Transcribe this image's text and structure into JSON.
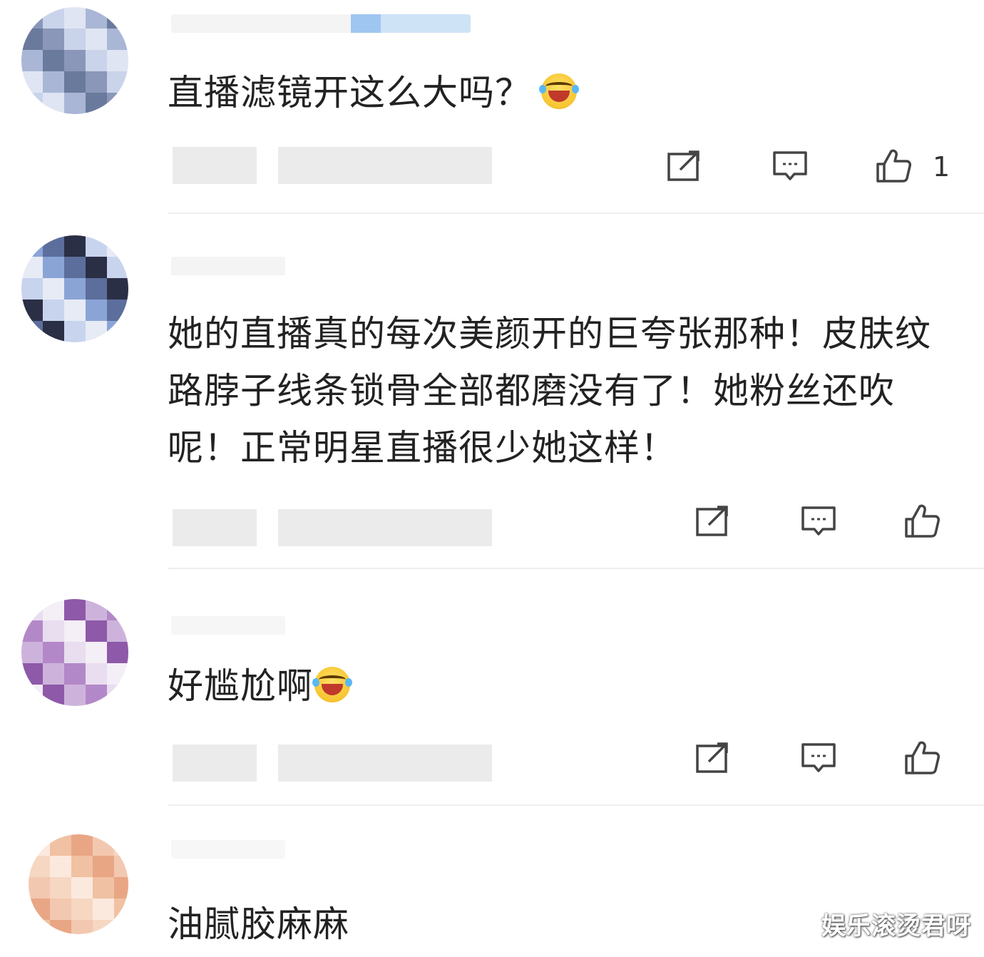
{
  "comments": [
    {
      "text": "直播滤镜开这么大吗？",
      "emoji": "laughing-tears-emoji",
      "like_count": "1",
      "avatar_colors": [
        "#8a97b8",
        "#a9b6d6",
        "#c9d3ea",
        "#6a7a9c",
        "#dfe5f2"
      ]
    },
    {
      "text": "她的直播真的每次美颜开的巨夸张那种！皮肤纹路脖子线条锁骨全部都磨没有了！她粉丝还吹 呢！正常明星直播很少她这样！",
      "like_count": "",
      "avatar_colors": [
        "#2b2f45",
        "#8aa4d6",
        "#c8d4ee",
        "#5c6e9c",
        "#e6ebf5"
      ]
    },
    {
      "text": "好尴尬啊",
      "emoji": "laughing-tears-emoji",
      "like_count": "",
      "avatar_colors": [
        "#b388c8",
        "#8e59a8",
        "#e9ddf0",
        "#cdb3dc",
        "#f4eef7"
      ]
    },
    {
      "text": "油腻胶麻麻",
      "like_count": "",
      "avatar_colors": [
        "#f0c1a2",
        "#f6d7c2",
        "#e9a684",
        "#fbe9de",
        "#f3c8b0"
      ]
    }
  ],
  "watermark": "娱乐滚烫君呀",
  "icons": {
    "share": "share-icon",
    "comment": "comment-icon",
    "like": "thumbs-up-icon"
  }
}
